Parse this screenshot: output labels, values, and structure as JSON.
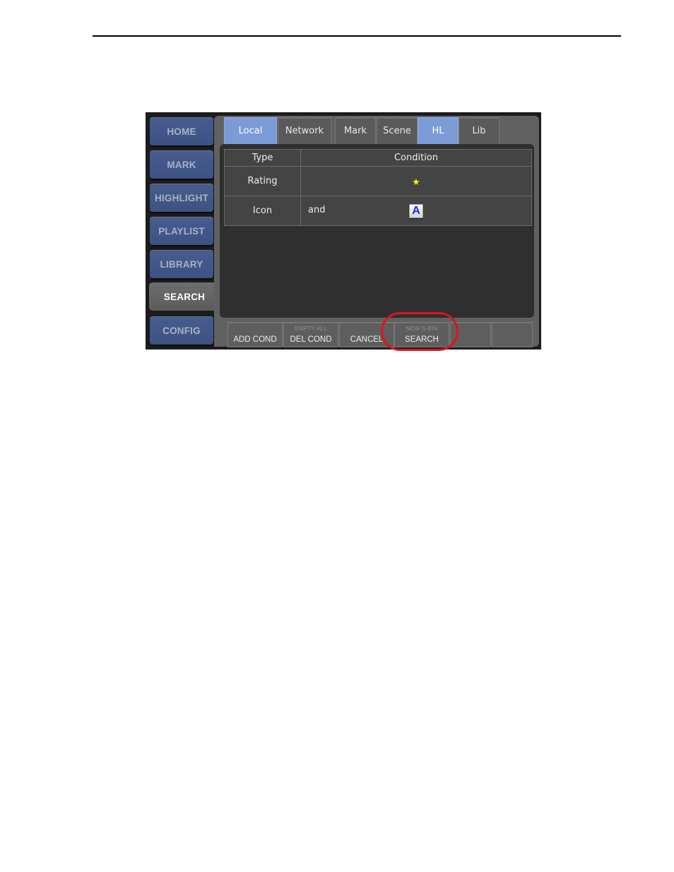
{
  "sidebar": {
    "items": [
      {
        "label": "HOME",
        "active": false
      },
      {
        "label": "MARK",
        "active": false
      },
      {
        "label": "HIGHLIGHT",
        "active": false
      },
      {
        "label": "PLAYLIST",
        "active": false
      },
      {
        "label": "LIBRARY",
        "active": false
      },
      {
        "label": "SEARCH",
        "active": true
      },
      {
        "label": "CONFIG",
        "active": false
      }
    ]
  },
  "tabs": {
    "location": [
      {
        "label": "Local",
        "active": true
      },
      {
        "label": "Network",
        "active": false
      }
    ],
    "category": [
      {
        "label": "Mark",
        "active": false
      },
      {
        "label": "Scene",
        "active": false
      },
      {
        "label": "HL",
        "active": true
      },
      {
        "label": "Lib",
        "active": false
      }
    ]
  },
  "table": {
    "headers": [
      "Type",
      "Condition"
    ],
    "rows": [
      {
        "type": "Rating",
        "operator": "",
        "value_icon": "star-icon",
        "value_glyph": "★"
      },
      {
        "type": "Icon",
        "operator": "and",
        "value_icon": "letter-a-icon",
        "value_glyph": "A"
      }
    ]
  },
  "bottom_buttons": [
    {
      "sub": "",
      "label": "ADD COND"
    },
    {
      "sub": "EMPTY ALL",
      "label": "DEL COND"
    },
    {
      "sub": "",
      "label": "CANCEL"
    },
    {
      "sub": "NEW S-BIN",
      "label": "SEARCH"
    },
    {
      "sub": "",
      "label": ""
    },
    {
      "sub": "",
      "label": ""
    }
  ],
  "colors": {
    "highlight_ring": "#e0151b",
    "active_tab": "#7b9bd6",
    "sidebar_button": "#475d8f",
    "star": "#ffee00"
  }
}
